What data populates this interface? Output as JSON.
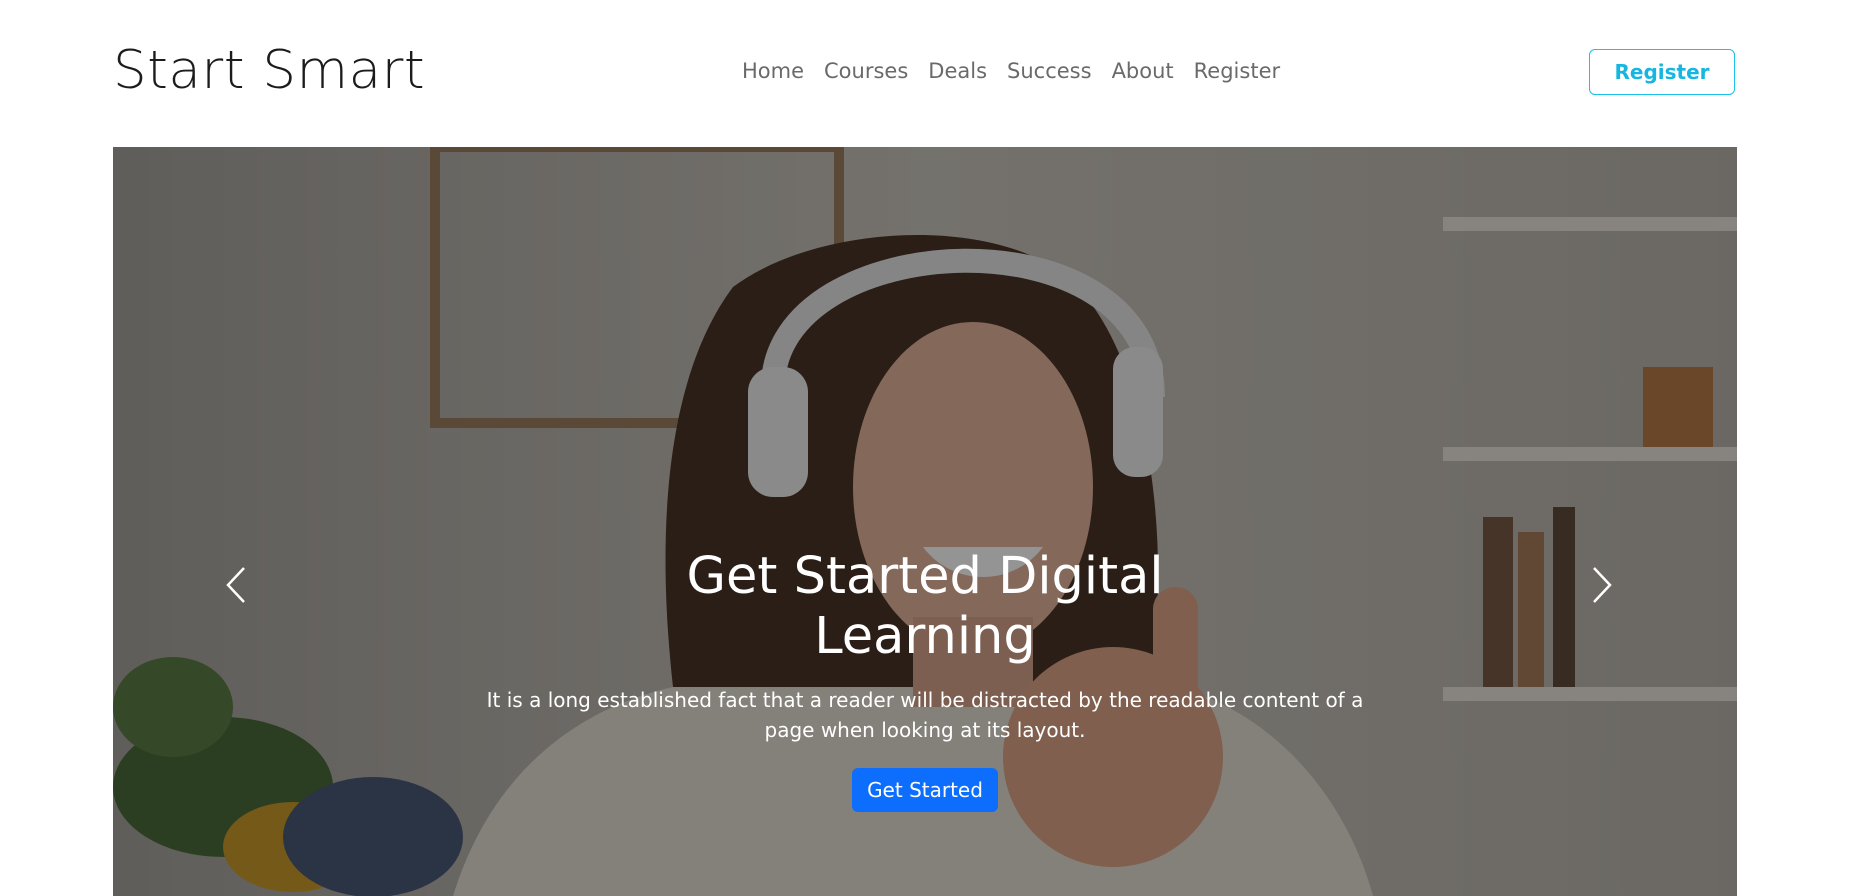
{
  "navbar": {
    "brand": "Start Smart",
    "links": [
      "Home",
      "Courses",
      "Deals",
      "Success",
      "About",
      "Register"
    ],
    "register_button": "Register"
  },
  "hero": {
    "title": "Get Started Digital Learning",
    "text": "It is a long established fact that a reader will be distracted by the readable content of a page when looking at its layout.",
    "cta": "Get Started"
  },
  "icons": {
    "prev": "chevron-left-icon",
    "next": "chevron-right-icon"
  },
  "colors": {
    "accent": "#17c1e8",
    "primary": "#0d6efd"
  }
}
